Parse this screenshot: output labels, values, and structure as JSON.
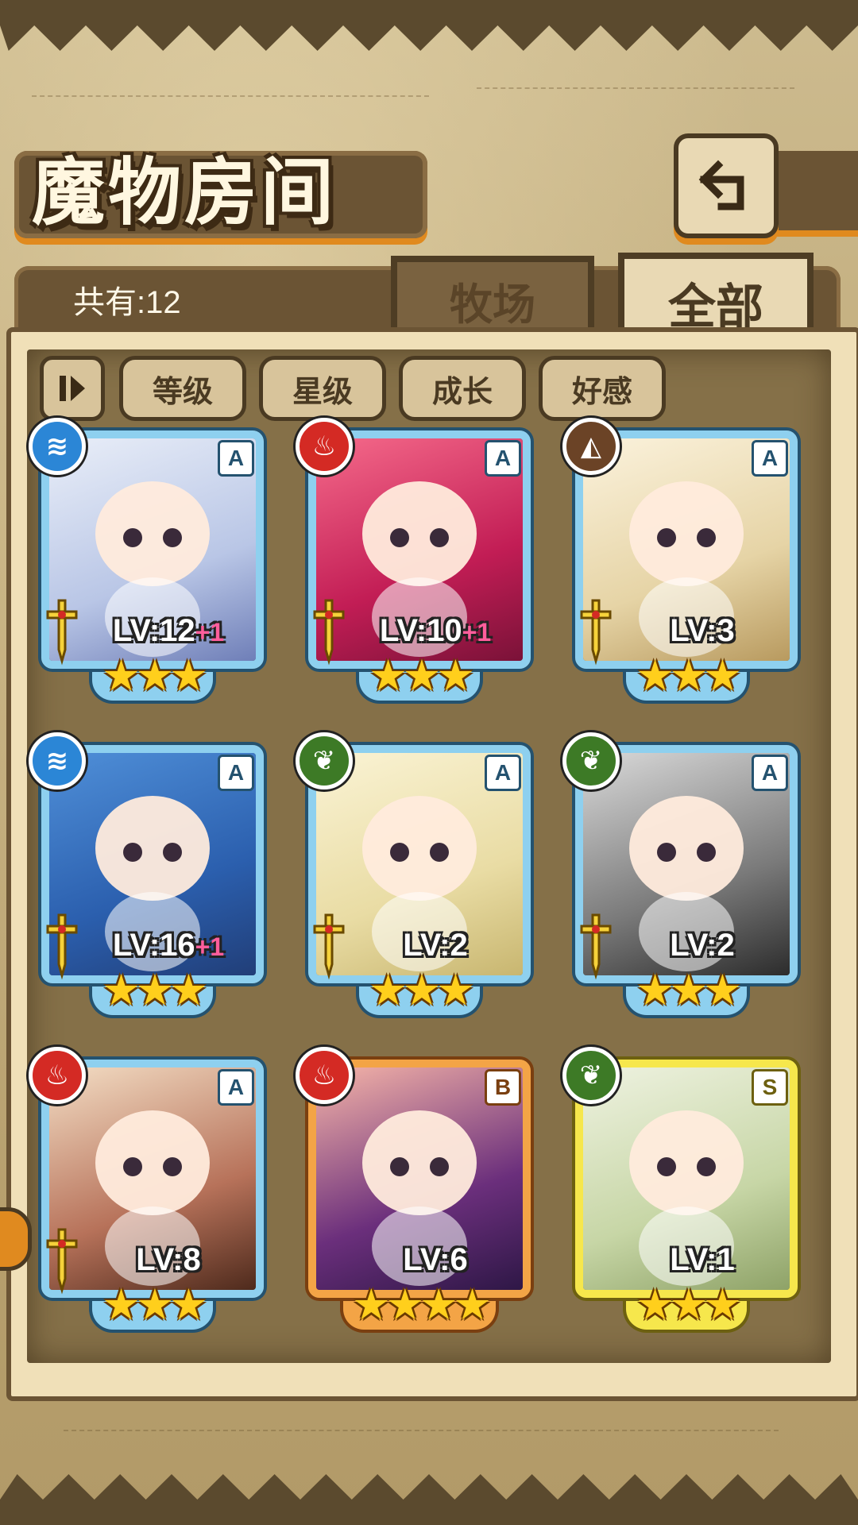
{
  "header": {
    "title": "魔物房间",
    "back_icon": "return-arrow-icon"
  },
  "count_label": "共有:12",
  "tabs": [
    {
      "label": "牧场",
      "active": false
    },
    {
      "label": "全部",
      "active": true
    }
  ],
  "sort_buttons": [
    {
      "label": "等级"
    },
    {
      "label": "星级"
    },
    {
      "label": "成长"
    },
    {
      "label": "好感"
    }
  ],
  "cards": [
    {
      "element": "water",
      "rank": "A",
      "level": "LV:12",
      "bonus": "+1",
      "stars": "★★★",
      "frame": "blue"
    },
    {
      "element": "fire",
      "rank": "A",
      "level": "LV:10",
      "bonus": "+1",
      "stars": "★★★",
      "frame": "blue"
    },
    {
      "element": "earth",
      "rank": "A",
      "level": "LV:3",
      "bonus": "",
      "stars": "★★★",
      "frame": "blue"
    },
    {
      "element": "water",
      "rank": "A",
      "level": "LV:16",
      "bonus": "+1",
      "stars": "★★★",
      "frame": "blue"
    },
    {
      "element": "wood",
      "rank": "A",
      "level": "LV:2",
      "bonus": "",
      "stars": "★★★",
      "frame": "blue"
    },
    {
      "element": "wood",
      "rank": "A",
      "level": "LV:2",
      "bonus": "",
      "stars": "★★★",
      "frame": "blue"
    },
    {
      "element": "fire",
      "rank": "A",
      "level": "LV:8",
      "bonus": "",
      "stars": "★★★",
      "frame": "blue"
    },
    {
      "element": "fire",
      "rank": "B",
      "level": "LV:6",
      "bonus": "",
      "stars": "★★★★",
      "frame": "orange"
    },
    {
      "element": "wood",
      "rank": "S",
      "level": "LV:1",
      "bonus": "",
      "stars": "★★★",
      "frame": "yellow"
    }
  ],
  "colors": {
    "accent_orange": "#e08a1f",
    "frame_blue": "#8ed0ef",
    "frame_orange": "#f3a446",
    "frame_yellow": "#f6e74c",
    "bonus_pink": "#ff5e9c"
  }
}
